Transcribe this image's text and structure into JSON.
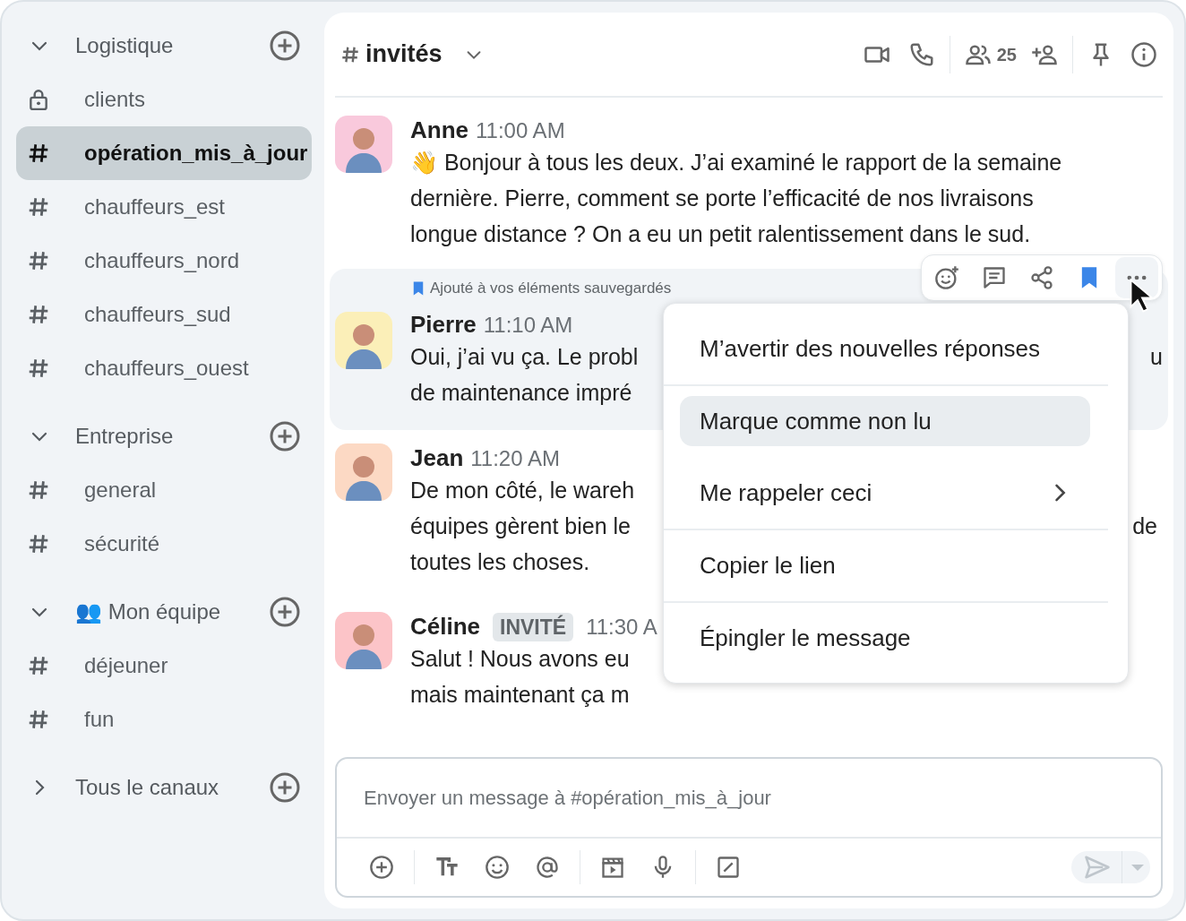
{
  "sidebar": {
    "sections": [
      {
        "title": "Logistique",
        "expanded": true,
        "items": [
          {
            "kind": "private",
            "label": "clients",
            "selected": false
          },
          {
            "kind": "channel",
            "label": "opération_mis_à_jour",
            "selected": true
          },
          {
            "kind": "channel",
            "label": "chauffeurs_est",
            "selected": false
          },
          {
            "kind": "channel",
            "label": "chauffeurs_nord",
            "selected": false
          },
          {
            "kind": "channel",
            "label": "chauffeurs_sud",
            "selected": false
          },
          {
            "kind": "channel",
            "label": "chauffeurs_ouest",
            "selected": false
          }
        ]
      },
      {
        "title": "Entreprise",
        "expanded": true,
        "items": [
          {
            "kind": "channel",
            "label": "general",
            "selected": false
          },
          {
            "kind": "channel",
            "label": "sécurité",
            "selected": false
          }
        ]
      },
      {
        "title": "👥 Mon équipe",
        "expanded": true,
        "items": [
          {
            "kind": "channel",
            "label": "déjeuner",
            "selected": false
          },
          {
            "kind": "channel",
            "label": "fun",
            "selected": false
          }
        ]
      },
      {
        "title": "Tous le canaux",
        "expanded": false
      }
    ]
  },
  "channel_header": {
    "name": "invités",
    "member_count": "25"
  },
  "messages": [
    {
      "author": "Anne",
      "time": "11:00 AM",
      "color": "#f9c9dc",
      "saved": false,
      "lines": [
        {
          "text": "👋 Bonjour à tous les deux. J’ai examiné le rapport de la semaine"
        },
        {
          "text": "dernière. Pierre, comment se porte l’efficacité de nos livraisons"
        },
        {
          "text": "longue distance ? On a eu un petit ralentissement dans le sud."
        }
      ]
    },
    {
      "author": "Pierre",
      "time": "11:10 AM",
      "color": "#fbefb8",
      "saved": true,
      "saved_label": "Ajouté à vos éléments sauvegardés",
      "lines": [
        {
          "text": "Oui, j’ai vu ça. Le probl",
          "tail": "u"
        },
        {
          "text": "de maintenance impré"
        }
      ]
    },
    {
      "author": "Jean",
      "time": "11:20 AM",
      "color": "#fcd9c4",
      "saved": false,
      "lines": [
        {
          "text": "De mon côté, le wareh"
        },
        {
          "text": "équipes gèrent bien le",
          "tail": "de"
        },
        {
          "text": "toutes les choses."
        }
      ]
    },
    {
      "author": "Céline",
      "badge": "INVITÉ",
      "time": "11:30 A",
      "color": "#fcc4c8",
      "saved": false,
      "lines": [
        {
          "text": "Salut ! Nous avons eu"
        },
        {
          "text": "mais maintenant ça m"
        }
      ]
    }
  ],
  "hover_toolbar": {
    "bookmarked": true
  },
  "context_menu": {
    "items": [
      {
        "kind": "item",
        "label": "M’avertir des nouvelles réponses",
        "selected": false,
        "submenu": false
      },
      {
        "kind": "divider"
      },
      {
        "kind": "item",
        "label": "Marque comme non lu",
        "selected": true,
        "submenu": false
      },
      {
        "kind": "item",
        "label": "Me rappeler ceci",
        "selected": false,
        "submenu": true
      },
      {
        "kind": "divider"
      },
      {
        "kind": "item",
        "label": "Copier le lien",
        "selected": false,
        "submenu": false
      },
      {
        "kind": "divider"
      },
      {
        "kind": "item",
        "label": "Épingler le message",
        "selected": false,
        "submenu": false
      }
    ]
  },
  "composer": {
    "placeholder": "Envoyer un message à #opération_mis_à_jour"
  }
}
